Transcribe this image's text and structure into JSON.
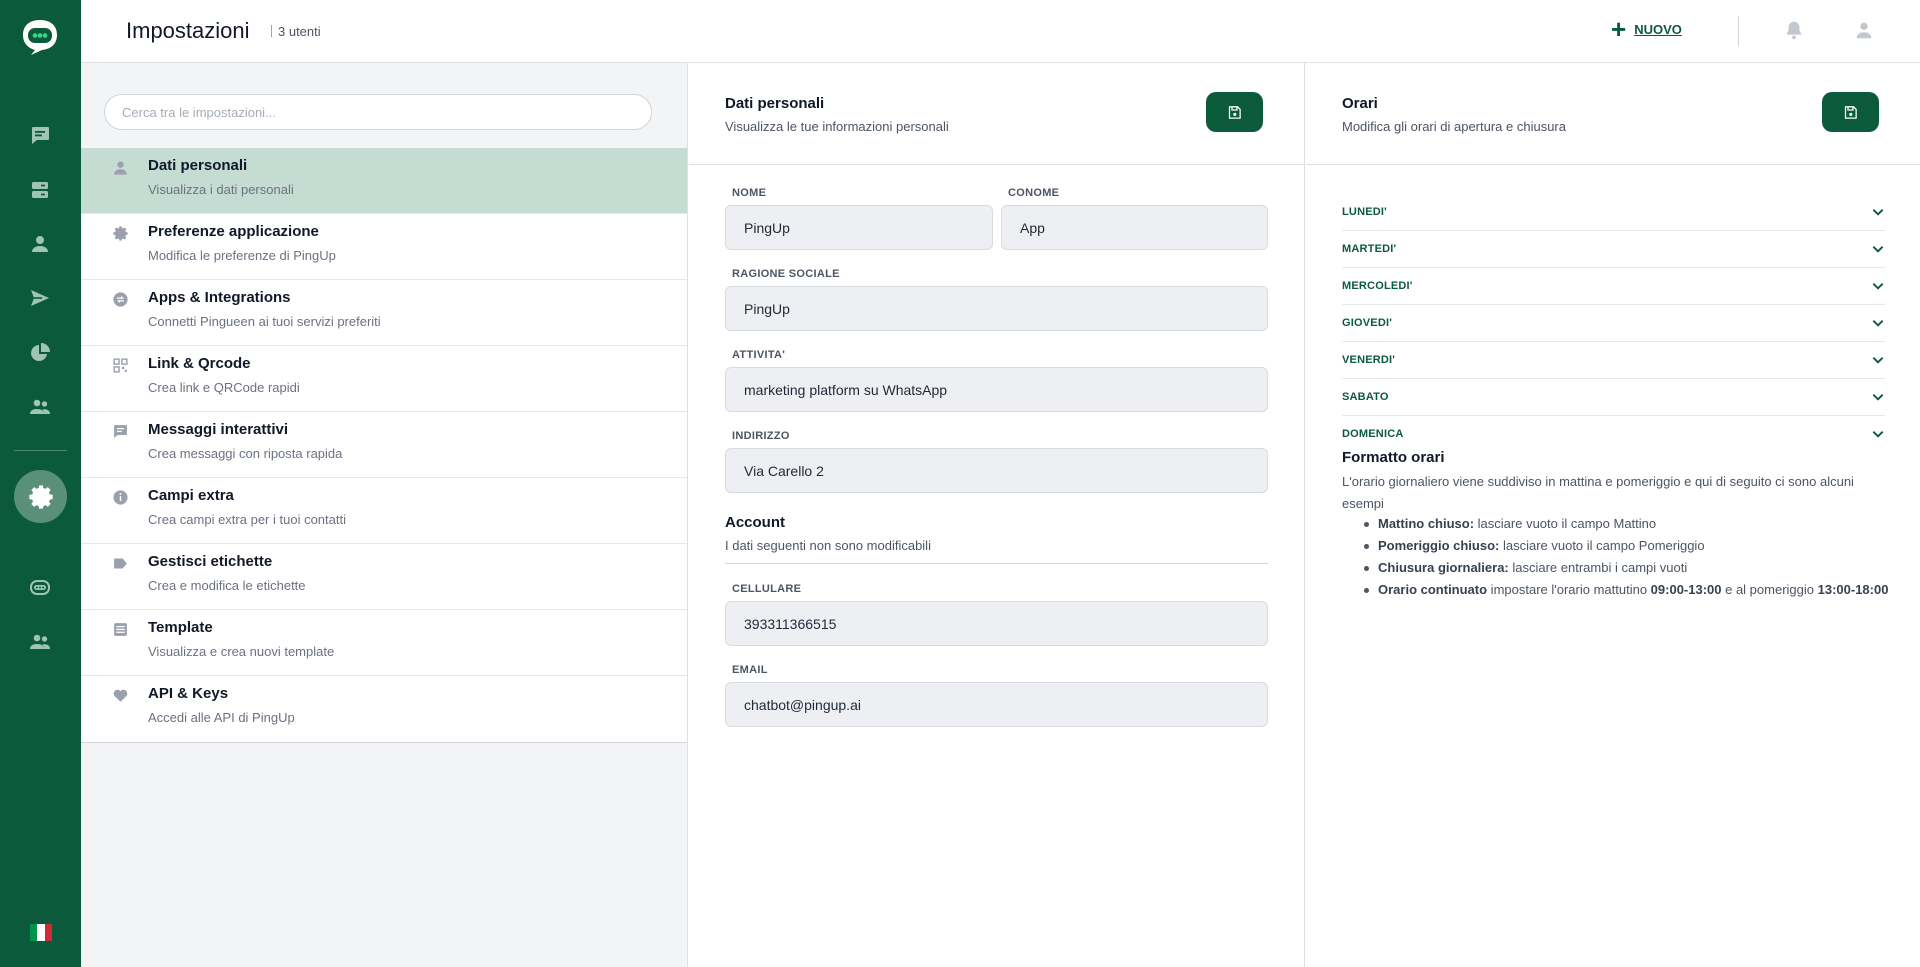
{
  "header": {
    "title": "Impostazioni",
    "users_count": "3 utenti",
    "new_label": "NUOVO"
  },
  "colors": {
    "brand": "#0c5a3c",
    "rail_active": "#5a8f79",
    "selected_item": "#c5dcd3"
  },
  "rail": {
    "icons": [
      "chat-icon",
      "database-icon",
      "contact-icon",
      "send-icon",
      "pie-chart-icon",
      "group-icon",
      "settings-icon",
      "bot-icon",
      "team-icon"
    ],
    "language_flag": "italian-flag-icon"
  },
  "search": {
    "placeholder": "Cerca tra le impostazioni..."
  },
  "settings_list": [
    {
      "icon": "user-icon",
      "title": "Dati personali",
      "subtitle": "Visualizza i dati personali",
      "selected": true
    },
    {
      "icon": "gear-icon",
      "title": "Preferenze applicazione",
      "subtitle": "Modifica le preferenze di PingUp",
      "selected": false
    },
    {
      "icon": "integrations-icon",
      "title": "Apps & Integrations",
      "subtitle": "Connetti Pingueen ai tuoi servizi preferiti",
      "selected": false
    },
    {
      "icon": "qrcode-icon",
      "title": "Link & Qrcode",
      "subtitle": "Crea link e QRCode rapidi",
      "selected": false
    },
    {
      "icon": "message-icon",
      "title": "Messaggi interattivi",
      "subtitle": "Crea messaggi con riposta rapida",
      "selected": false
    },
    {
      "icon": "info-icon",
      "title": "Campi extra",
      "subtitle": "Crea campi extra per i tuoi contatti",
      "selected": false
    },
    {
      "icon": "tag-icon",
      "title": "Gestisci etichette",
      "subtitle": "Crea e modifica le etichette",
      "selected": false
    },
    {
      "icon": "template-icon",
      "title": "Template",
      "subtitle": "Visualizza e crea nuovi template",
      "selected": false
    },
    {
      "icon": "heart-icon",
      "title": "API & Keys",
      "subtitle": "Accedi alle API di PingUp",
      "selected": false
    }
  ],
  "personal": {
    "title": "Dati personali",
    "subtitle": "Visualizza le tue informazioni personali",
    "nome_label": "NOME",
    "nome_value": "PingUp",
    "cognome_label": "CONOME",
    "cognome_value": "App",
    "ragione_label": "RAGIONE SOCIALE",
    "ragione_value": "PingUp",
    "attivita_label": "ATTIVITA'",
    "attivita_value": "marketing platform su WhatsApp",
    "indirizzo_label": "INDIRIZZO",
    "indirizzo_value": "Via Carello 2",
    "account_title": "Account",
    "account_subtitle": "I dati seguenti non sono modificabili",
    "cellulare_label": "CELLULARE",
    "cellulare_value": "393311366515",
    "email_label": "EMAIL",
    "email_value": "chatbot@pingup.ai"
  },
  "hours": {
    "title": "Orari",
    "subtitle": "Modifica gli orari di apertura e chiusura",
    "days": [
      "LUNEDI'",
      "MARTEDI'",
      "MERCOLEDI'",
      "GIOVEDI'",
      "VENERDI'",
      "SABATO",
      "DOMENICA"
    ],
    "format_title": "Formatto orari",
    "format_desc": "L'orario giornaliero viene suddiviso in mattina e pomeriggio e qui di seguito ci sono alcuni esempi",
    "examples": [
      {
        "bold": "Mattino chiuso:",
        "text": " lasciare vuoto il campo Mattino"
      },
      {
        "bold": "Pomeriggio chiuso:",
        "text": " lasciare vuoto il campo Pomeriggio"
      },
      {
        "bold": "Chiusura giornaliera:",
        "text": " lasciare entrambi i campi vuoti"
      }
    ],
    "continuous": {
      "bold": "Orario continuato",
      "text1": " impostare l'orario mattutino ",
      "bold2": "09:00-13:00",
      "text2": " e al pomeriggio ",
      "bold3": "13:00-18:00"
    }
  }
}
